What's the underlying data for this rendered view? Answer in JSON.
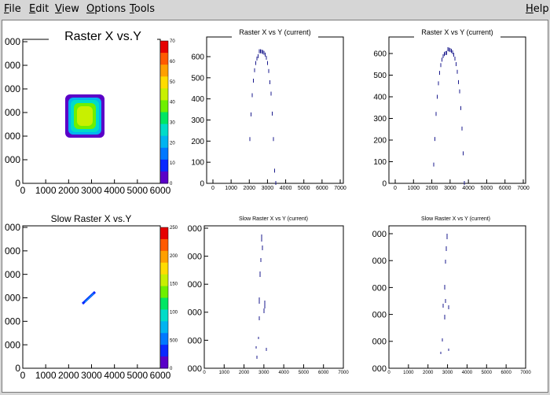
{
  "menu": {
    "items": [
      {
        "label": "File",
        "accel": "F",
        "rest": "ile"
      },
      {
        "label": "Edit",
        "accel": "E",
        "rest": "dit"
      },
      {
        "label": "View",
        "accel": "V",
        "rest": "iew"
      },
      {
        "label": "Options",
        "accel": "O",
        "rest": "ptions"
      },
      {
        "label": "Tools",
        "accel": "T",
        "rest": "ools"
      }
    ],
    "help": {
      "label": "Help",
      "accel": "H",
      "rest": "elp"
    }
  },
  "colors": {
    "menubar_bg": "#d6d6d6",
    "canvas_bg": "#ffffff",
    "marker": "#1a1a8c",
    "palette": [
      "#5a00c8",
      "#0a28ff",
      "#0078ff",
      "#00b4f0",
      "#00dcc8",
      "#00e664",
      "#6ef000",
      "#c8f000",
      "#ffdc00",
      "#ffa000",
      "#ff5a00",
      "#e60000"
    ]
  },
  "panels": {
    "raster_xy": {
      "title": "Raster X vs.Y",
      "y_ticks": [
        "000",
        "000",
        "000",
        "000",
        "000",
        "000",
        "0"
      ],
      "x_ticks": [
        "0",
        "1000",
        "2000",
        "3000",
        "4000",
        "5000",
        "6000"
      ],
      "palette_ticks": [
        "70",
        "60",
        "50",
        "40",
        "30",
        "20",
        "10",
        "0"
      ]
    },
    "raster_current_1": {
      "title": "Raster X vs Y (current)",
      "y_ticks": [
        "600",
        "500",
        "400",
        "300",
        "200",
        "100",
        "0"
      ],
      "x_ticks": [
        "0",
        "1000",
        "2000",
        "3000",
        "4000",
        "5000",
        "6000",
        "7000"
      ]
    },
    "raster_current_2": {
      "title": "Raster X vs Y (current)",
      "y_ticks": [
        "600",
        "500",
        "400",
        "300",
        "200",
        "100",
        "0"
      ],
      "x_ticks": [
        "0",
        "1000",
        "2000",
        "3000",
        "4000",
        "5000",
        "6000",
        "7000"
      ]
    },
    "slow_raster_xy": {
      "title": "Slow Raster X vs.Y",
      "y_ticks": [
        "000",
        "000",
        "000",
        "000",
        "000",
        "000",
        "0"
      ],
      "x_ticks": [
        "0",
        "1000",
        "2000",
        "3000",
        "4000",
        "5000",
        "6000"
      ],
      "palette_ticks": [
        "250",
        "200",
        "150",
        "100",
        "500",
        "0"
      ]
    },
    "slow_current_1": {
      "title": "Slow Raster X vs Y (current)",
      "y_ticks": [
        "000",
        "000",
        "000",
        "000",
        "000",
        "000"
      ],
      "x_ticks": [
        "0",
        "1000",
        "2000",
        "3000",
        "4000",
        "5000",
        "6000",
        "7000"
      ]
    },
    "slow_current_2": {
      "title": "Slow Raster X vs Y (current)",
      "y_ticks": [
        "000",
        "000",
        "000",
        "000",
        "000",
        "000"
      ],
      "x_ticks": [
        "0",
        "1000",
        "2000",
        "3000",
        "4000",
        "5000",
        "6000",
        "7000"
      ]
    }
  }
}
